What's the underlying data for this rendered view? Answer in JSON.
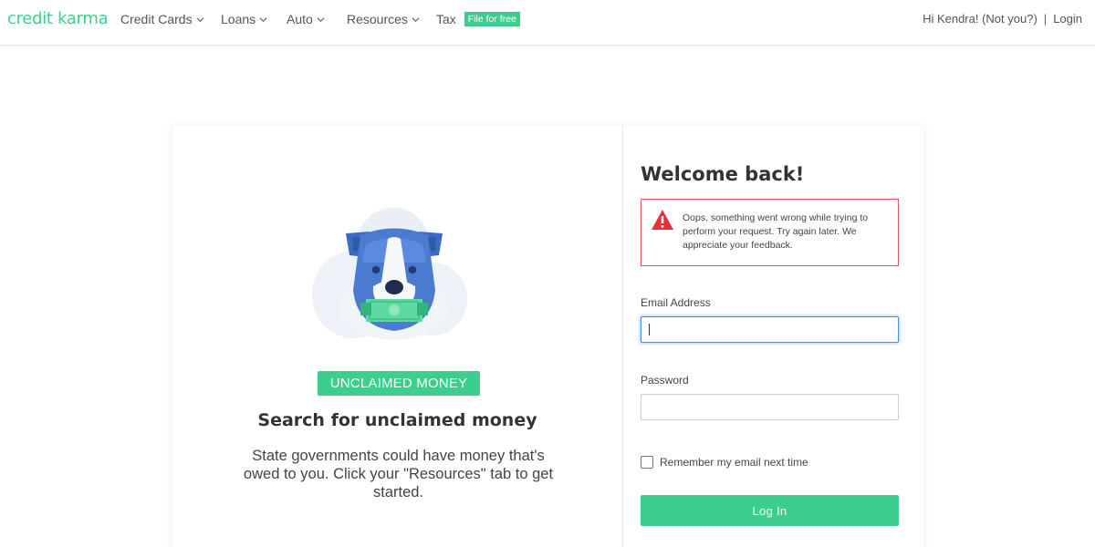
{
  "brand": {
    "logo_text": "credit karma",
    "accent_color": "#3cce8c",
    "error_color": "#e05560"
  },
  "nav": {
    "items": [
      {
        "label": "Credit Cards",
        "icon": "chevron-down-icon"
      },
      {
        "label": "Loans",
        "icon": "chevron-down-icon"
      },
      {
        "label": "Auto",
        "icon": "chevron-down-icon"
      },
      {
        "label": "Resources",
        "icon": "chevron-down-icon"
      },
      {
        "label": "Tax",
        "badge": "File for free"
      }
    ],
    "greeting": "Hi Kendra! (Not you?)",
    "separator": "|",
    "login_link": "Login"
  },
  "promo": {
    "pill": "UNCLAIMED MONEY",
    "headline": "Search for unclaimed money",
    "body": "State governments could have money that's owed to you. Click your \"Resources\" tab to get started."
  },
  "login_form": {
    "title": "Welcome back!",
    "error_message": "Oops, something went wrong while trying to perform your request. Try again later. We appreciate your feedback.",
    "email_label": "Email Address",
    "email_value": "",
    "password_label": "Password",
    "password_value": "",
    "remember_label": "Remember my email next time",
    "remember_checked": false,
    "submit_label": "Log In"
  }
}
